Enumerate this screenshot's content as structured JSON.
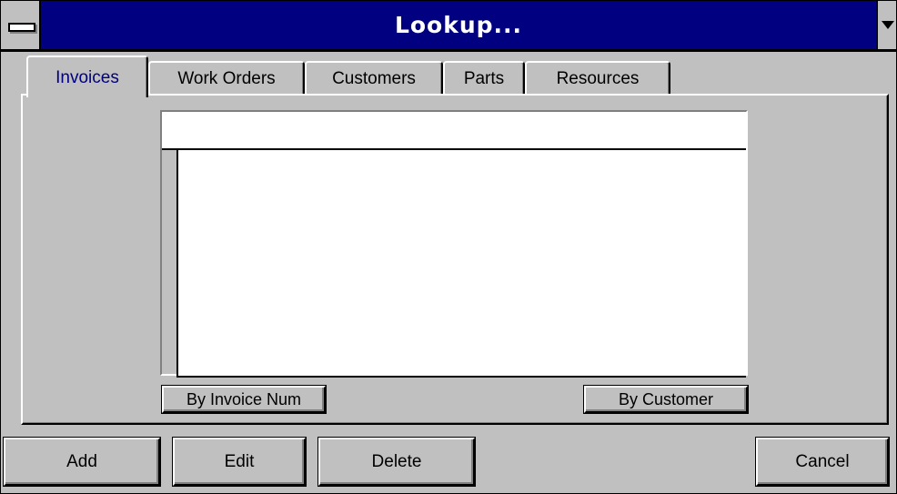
{
  "window": {
    "title": "Lookup..."
  },
  "icons": {
    "system_menu": "system-menu-icon",
    "dropdown": "triangle-down-icon"
  },
  "tabs": [
    {
      "label": "Invoices",
      "active": true
    },
    {
      "label": "Work Orders",
      "active": false
    },
    {
      "label": "Customers",
      "active": false
    },
    {
      "label": "Parts",
      "active": false
    },
    {
      "label": "Resources",
      "active": false
    }
  ],
  "panel": {
    "sort_buttons": {
      "by_invoice_num": "By Invoice Num",
      "by_customer": "By Customer"
    }
  },
  "actions": {
    "add": "Add",
    "edit": "Edit",
    "delete": "Delete",
    "cancel": "Cancel"
  },
  "colors": {
    "titlebar": "#000080",
    "face": "#c0c0c0",
    "active_tab_text": "#000080"
  }
}
